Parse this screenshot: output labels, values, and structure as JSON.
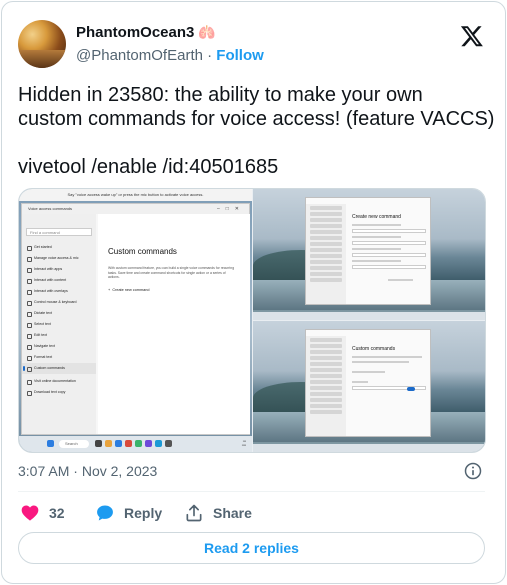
{
  "author": {
    "name": "PhantomOcean3",
    "emoji": "🫁",
    "handle": "@PhantomOfEarth",
    "separator": "·",
    "follow_label": "Follow"
  },
  "tweet": {
    "lines": [
      "Hidden in 23580: the ability to make your own",
      "custom commands for voice access! (feature VACCS)",
      "vivetool /enable /id:40501685"
    ]
  },
  "media": {
    "voice_banner": "Say \"voice access wake up\" or press the mic button to activate voice access.",
    "window_title": "Voice access commands",
    "search_placeholder": "Find a command",
    "sidebar_items": [
      "Get started",
      "Manage voice access & mic",
      "Interact with apps",
      "Interact with content",
      "Interact with overlays",
      "Control mouse & keyboard",
      "Dictate text",
      "Select text",
      "Edit text",
      "Navigate text",
      "Format text",
      "Custom commands",
      "Visit online documentation",
      "Download text copy"
    ],
    "heading": "Custom commands",
    "description": "With custom command feature, you can build a single voice commands for recurring tasks. Save time and create command shortcuts for single action or a series of actions.",
    "add_label": "Create new command",
    "taskbar_search": "Search",
    "right_top_heading": "Create new command",
    "right_bottom_heading": "Custom commands"
  },
  "meta": {
    "time": "3:07 AM",
    "separator": "·",
    "date": "Nov 2, 2023"
  },
  "actions": {
    "like_count": "32",
    "reply_label": "Reply",
    "share_label": "Share"
  },
  "read_replies_label": "Read 2 replies",
  "colors": {
    "accent": "#1d9bf0",
    "like": "#f91880",
    "muted": "#536471"
  }
}
